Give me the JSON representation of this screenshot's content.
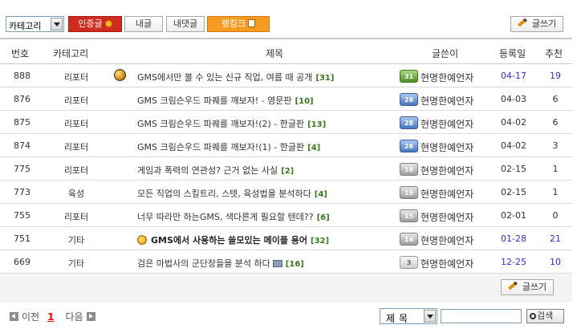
{
  "toolbar": {
    "category_select": "카테고리",
    "cert_label": "인증글",
    "my_posts_label": "내글",
    "my_comments_label": "내댓글",
    "ranking_label": "랭킹크",
    "write_label": "글쓰기"
  },
  "header": {
    "no": "번호",
    "category": "카테고리",
    "title": "제목",
    "author": "글쓴이",
    "date": "등록일",
    "recommend": "추천"
  },
  "rows": [
    {
      "no": "888",
      "category": "리포터",
      "title": "GMS에서만 볼 수 있는 신규 직업, 여름 때 공개",
      "comments": "[31]",
      "badge": "31",
      "badge_color": "green",
      "author": "현명한예언자",
      "date": "04-17",
      "recommend": "19",
      "highlight": true,
      "icon": "globe-icon"
    },
    {
      "no": "876",
      "category": "리포터",
      "title": "GMS 크림슨우드 파퀘를 깨보자! - 영문판",
      "comments": "[10]",
      "badge": "28",
      "badge_color": "blue",
      "author": "현명한예언자",
      "date": "04-03",
      "recommend": "6",
      "highlight": false
    },
    {
      "no": "875",
      "category": "리포터",
      "title": "GMS 크림슨우드 파퀘를 깨보자!(2) - 한글판",
      "comments": "[13]",
      "badge": "28",
      "badge_color": "blue",
      "author": "현명한예언자",
      "date": "04-02",
      "recommend": "6",
      "highlight": false
    },
    {
      "no": "874",
      "category": "리포터",
      "title": "GMS 크림슨우드 파퀘를 깨보자!(1) - 한글판",
      "comments": "[4]",
      "badge": "28",
      "badge_color": "blue",
      "author": "현명한예언자",
      "date": "04-02",
      "recommend": "3",
      "highlight": false
    },
    {
      "no": "775",
      "category": "리포터",
      "title": "게임과 폭력의 연관성? 근거 없는 사실",
      "comments": "[2]",
      "badge": "19",
      "badge_color": "gray",
      "author": "현명한예언자",
      "date": "02-15",
      "recommend": "1",
      "highlight": false
    },
    {
      "no": "773",
      "category": "육성",
      "title": "모든 직업의 스킬트리, 스텟, 육성법을 분석하다",
      "comments": "[4]",
      "badge": "19",
      "badge_color": "gray",
      "author": "현명한예언자",
      "date": "02-15",
      "recommend": "1",
      "highlight": false
    },
    {
      "no": "755",
      "category": "리포터",
      "title": "너무 따라만 하는GMS, 색다른게 필요할 텐데??",
      "comments": "[6]",
      "badge": "15",
      "badge_color": "gray",
      "author": "현명한예언자",
      "date": "02-01",
      "recommend": "0",
      "highlight": false
    },
    {
      "no": "751",
      "category": "기타",
      "title": "GMS에서 사용하는 쓸모있는 메이플 용어",
      "comments": "[32]",
      "badge": "14",
      "badge_color": "gray",
      "author": "현명한예언자",
      "date": "01-28",
      "recommend": "21",
      "highlight": true,
      "bold": true,
      "icon": "medal-icon"
    },
    {
      "no": "669",
      "category": "기타",
      "title": "검은 마법사의 군단장들을 분석 하다",
      "comments": "[16]",
      "badge": "3",
      "badge_color": "light",
      "author": "현명한예언자",
      "date": "12-25",
      "recommend": "10",
      "highlight": true,
      "image_icon": true
    }
  ],
  "pager": {
    "prev": "이전",
    "current": "1",
    "next": "다음"
  },
  "search": {
    "field_select": "제목",
    "button_label": "검색",
    "query": ""
  }
}
